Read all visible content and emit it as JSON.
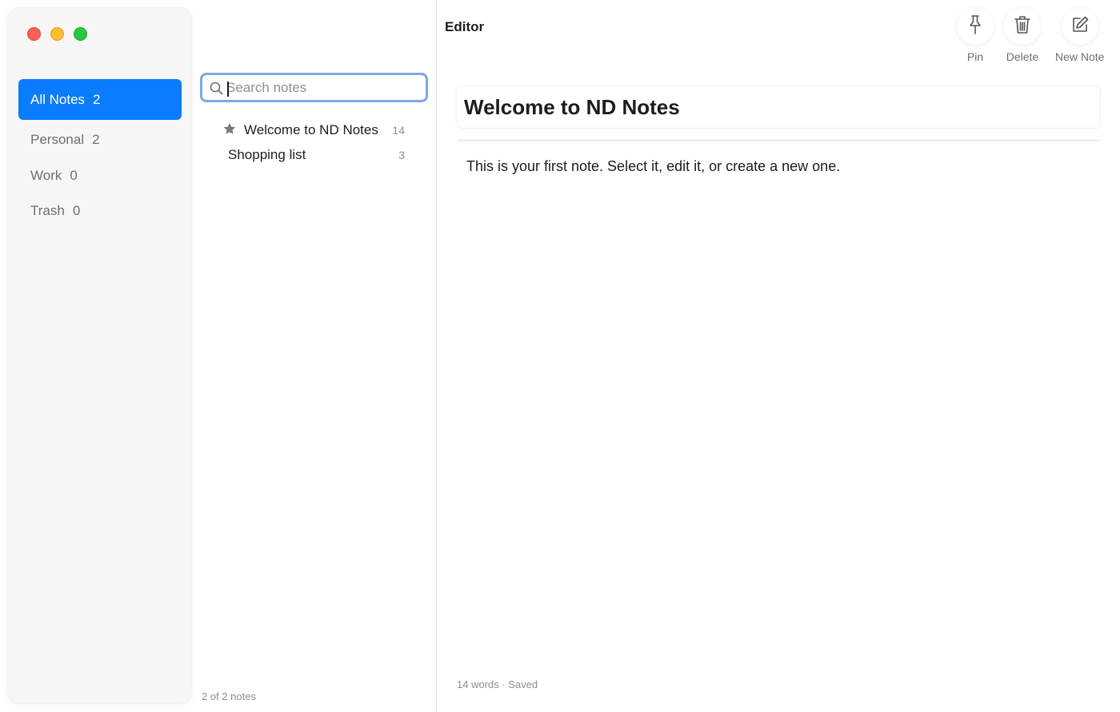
{
  "window": {
    "traffic_lights": [
      "close",
      "minimize",
      "zoom"
    ],
    "colors": {
      "close": "#ff5f57",
      "minimize": "#febc2e",
      "zoom": "#28c840",
      "accent": "#0a7cff"
    }
  },
  "sidebar": {
    "folders": [
      {
        "label": "All Notes",
        "count": "2",
        "active": true
      },
      {
        "label": "Personal",
        "count": "2",
        "active": false
      },
      {
        "label": "Work",
        "count": "0",
        "active": false
      },
      {
        "label": "Trash",
        "count": "0",
        "active": false
      }
    ]
  },
  "notes_list": {
    "search": {
      "placeholder": "Search notes",
      "value": "",
      "icon": "search-icon"
    },
    "items": [
      {
        "title": "Welcome to ND Notes",
        "word_count": "14",
        "pinned": true,
        "icon": "star-icon"
      },
      {
        "title": "Shopping list",
        "word_count": "3",
        "pinned": false
      }
    ],
    "footer": "2 of 2 notes"
  },
  "editor": {
    "header": "Editor",
    "toolbar": {
      "pin_label": "Pin",
      "delete_label": "Delete",
      "new_note_label": "New Note",
      "icons": [
        "pin-icon",
        "trash-icon",
        "compose-icon"
      ]
    },
    "note_title": "Welcome to ND Notes",
    "note_body": "This is your first note. Select it, edit it, or create a new one.",
    "status": "14 words · Saved"
  }
}
